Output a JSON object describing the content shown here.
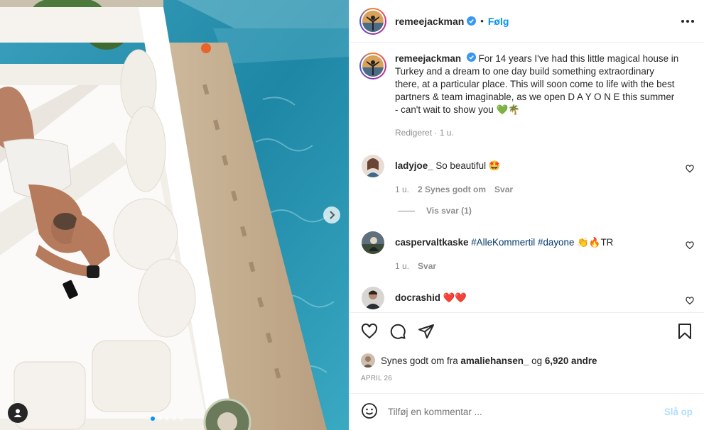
{
  "post": {
    "username": "remeejackman",
    "separator": "•",
    "follow_label": "Følg",
    "caption_text": "For 14 years I've had this little magical house in Turkey and a dream to one day build something extraordinary there, at a particular place. This will soon come to life with the best partners & team imaginable, as we open D A Y O N E this summer - can't wait to show you 💚🌴",
    "caption_meta": "Redigeret · 1 u."
  },
  "comments": [
    {
      "username": "ladyjoe_",
      "text": "So beautiful 🤩",
      "time": "1 u.",
      "likes": "2 Synes godt om",
      "reply": "Svar",
      "view_replies": "Vis svar (1)"
    },
    {
      "username": "caspervaltkaske",
      "tags": [
        "#AlleKommertil",
        "#dayone"
      ],
      "emoji": "👏🔥TR",
      "time": "1 u.",
      "reply": "Svar"
    },
    {
      "username": "docrashid",
      "text": "❤️❤️"
    }
  ],
  "likes": {
    "prefix": "Synes godt om fra",
    "user": "amaliehansen_",
    "connector": "og",
    "others": "6,920 andre"
  },
  "date": "APRIL 26",
  "add_comment": {
    "placeholder": "Tilføj en kommentar ...",
    "post_label": "Slå op"
  },
  "colors": {
    "accent": "#0095f6",
    "text": "#262626",
    "muted": "#8e8e8e",
    "post_disabled": "#b2dffc"
  },
  "icons": [
    "verified-icon",
    "more-icon",
    "heart-icon",
    "comment-icon",
    "share-icon",
    "bookmark-icon",
    "emoji-icon",
    "chevron-right-icon",
    "user-tag-icon"
  ]
}
